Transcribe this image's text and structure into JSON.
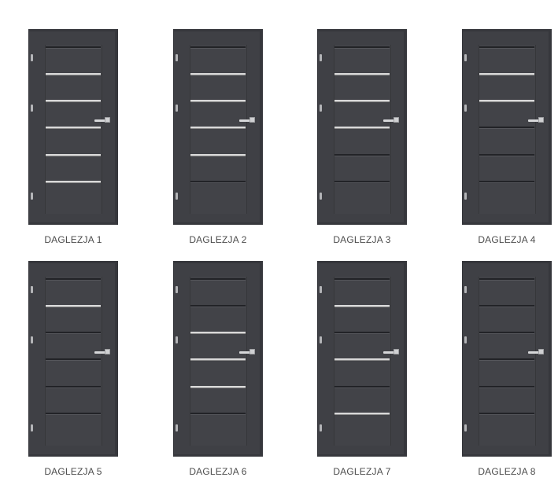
{
  "doors": [
    {
      "label": "DAGLEZJA 1",
      "grooves": [
        "dark",
        "glass",
        "glass",
        "glass",
        "glass",
        "glass"
      ]
    },
    {
      "label": "DAGLEZJA 2",
      "grooves": [
        "dark",
        "glass",
        "glass",
        "glass",
        "glass",
        "dark"
      ]
    },
    {
      "label": "DAGLEZJA 3",
      "grooves": [
        "dark",
        "glass",
        "glass",
        "glass",
        "dark",
        "dark"
      ]
    },
    {
      "label": "DAGLEZJA 4",
      "grooves": [
        "dark",
        "glass",
        "glass",
        "dark",
        "dark",
        "dark"
      ]
    },
    {
      "label": "DAGLEZJA 5",
      "grooves": [
        "dark",
        "glass",
        "dark",
        "dark",
        "dark",
        "dark"
      ]
    },
    {
      "label": "DAGLEZJA 6",
      "grooves": [
        "dark",
        "dark",
        "glass",
        "glass",
        "glass",
        "dark"
      ]
    },
    {
      "label": "DAGLEZJA 7",
      "grooves": [
        "dark",
        "glass",
        "dark",
        "glass",
        "dark",
        "glass"
      ]
    },
    {
      "label": "DAGLEZJA 8",
      "grooves": [
        "dark",
        "dark",
        "dark",
        "dark",
        "dark",
        "dark"
      ]
    }
  ],
  "colors": {
    "door": "#3f4045",
    "glass_strip": "#d9d9d9",
    "dark_groove": "#222327",
    "label_text": "#4d4d4d"
  }
}
